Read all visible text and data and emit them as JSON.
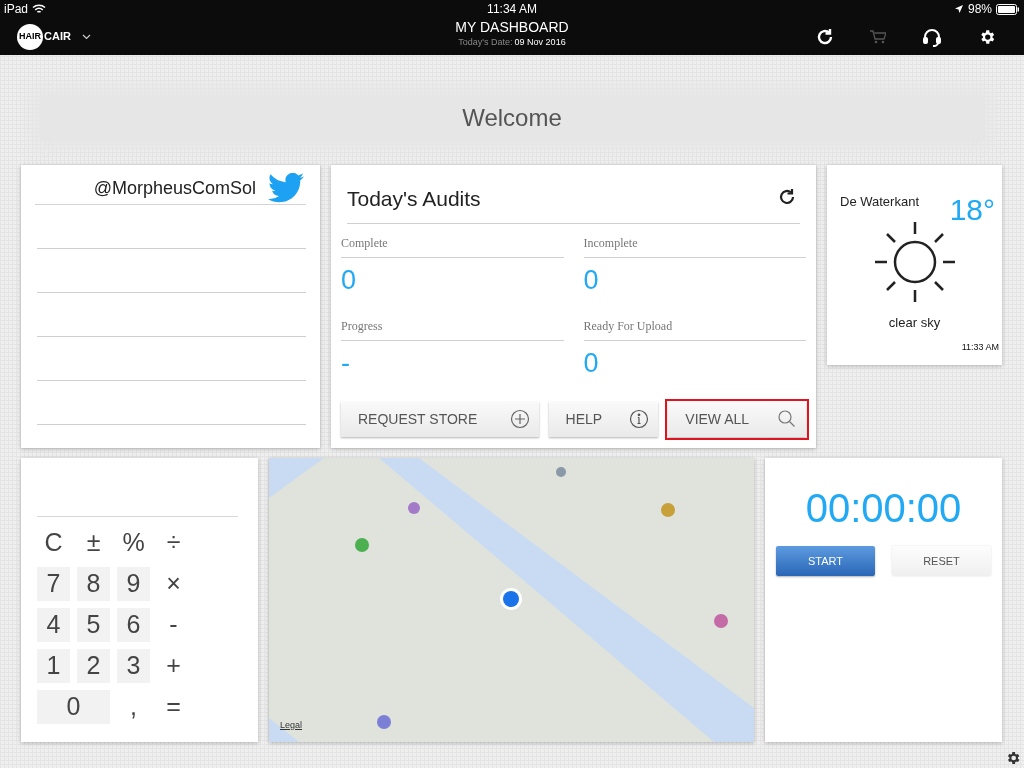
{
  "status_bar": {
    "device": "iPad",
    "time": "11:34 AM",
    "battery": "98%"
  },
  "header": {
    "logo": [
      "HAIR",
      "CAIR"
    ],
    "title": "MY DASHBOARD",
    "date_label": "Today's Date:",
    "date": "09 Nov 2016"
  },
  "banner": {
    "title": "Welcome"
  },
  "twitter": {
    "handle": "@MorpheusComSol"
  },
  "audits": {
    "title": "Today's Audits",
    "stats": [
      {
        "label": "Complete",
        "value": "0"
      },
      {
        "label": "Incomplete",
        "value": "0"
      },
      {
        "label": "Progress",
        "value": "-"
      },
      {
        "label": "Ready For Upload",
        "value": "0"
      }
    ],
    "buttons": [
      {
        "label": "REQUEST STORE",
        "kind": "plus",
        "highlighted": false
      },
      {
        "label": "HELP",
        "kind": "info",
        "highlighted": false
      },
      {
        "label": "VIEW ALL",
        "kind": "search",
        "highlighted": true
      }
    ]
  },
  "weather": {
    "location": "De Waterkant",
    "temperature": "18°",
    "condition": "clear sky",
    "updated": "11:33 AM"
  },
  "calculator": {
    "keys": [
      {
        "label": "C",
        "kind": "op",
        "wide": false
      },
      {
        "label": "±",
        "kind": "op",
        "wide": false
      },
      {
        "label": "%",
        "kind": "op",
        "wide": false
      },
      {
        "label": "÷",
        "kind": "op",
        "wide": false
      },
      {
        "label": "7",
        "kind": "digit",
        "wide": false
      },
      {
        "label": "8",
        "kind": "digit",
        "wide": false
      },
      {
        "label": "9",
        "kind": "digit",
        "wide": false
      },
      {
        "label": "×",
        "kind": "op",
        "wide": false
      },
      {
        "label": "4",
        "kind": "digit",
        "wide": false
      },
      {
        "label": "5",
        "kind": "digit",
        "wide": false
      },
      {
        "label": "6",
        "kind": "digit",
        "wide": false
      },
      {
        "label": "-",
        "kind": "op",
        "wide": false
      },
      {
        "label": "1",
        "kind": "digit",
        "wide": false
      },
      {
        "label": "2",
        "kind": "digit",
        "wide": false
      },
      {
        "label": "3",
        "kind": "digit",
        "wide": false
      },
      {
        "label": "+",
        "kind": "op",
        "wide": false
      },
      {
        "label": "0",
        "kind": "digit",
        "wide": true
      },
      {
        "label": ",",
        "kind": "op",
        "wide": false
      },
      {
        "label": "=",
        "kind": "op",
        "wide": false
      }
    ]
  },
  "map": {
    "legal": "Legal"
  },
  "stopwatch": {
    "time": "00:00:00",
    "buttons": [
      {
        "label": "START",
        "kind": "primary"
      },
      {
        "label": "RESET",
        "kind": "secondary"
      }
    ]
  }
}
